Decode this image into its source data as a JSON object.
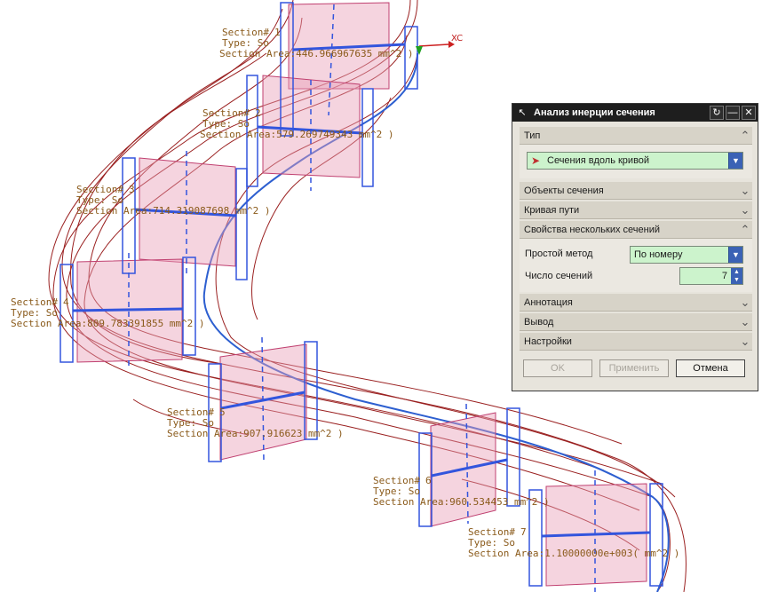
{
  "viewport": {
    "axis_label": "XC",
    "section_labels": [
      {
        "name": "Section#",
        "num": "1",
        "type": "Type: So",
        "area": "Section Area:446.966967635 mm^2 )"
      },
      {
        "name": "Section#",
        "num": "2",
        "type": "Type: So",
        "area": "Section Area:579.269749343 mm^2 )"
      },
      {
        "name": "Section#",
        "num": "3",
        "type": "Type: So",
        "area": "Section Area:714.319087698 mm^2 )"
      },
      {
        "name": "Section#",
        "num": "4",
        "type": "Type: So",
        "area": "Section Area:809.783391855 mm^2 )"
      },
      {
        "name": "Section#",
        "num": "5",
        "type": "Type: So",
        "area": "Section Area:907.916623 mm^2 )"
      },
      {
        "name": "Section#",
        "num": "6",
        "type": "Type: So",
        "area": "Section Area:960.534453 mm^2 )"
      },
      {
        "name": "Section#",
        "num": "7",
        "type": "Type: So",
        "area": "Section Area:1.10000000e+003( mm^2 )"
      }
    ]
  },
  "dialog": {
    "title": "Анализ инерции сечения",
    "icons": {
      "app": "cursor-icon",
      "reset": "reset-icon",
      "minimize": "minimize-icon",
      "close": "close-icon"
    },
    "sections": {
      "type": "Тип",
      "objects": "Объекты сечения",
      "path": "Кривая пути",
      "multi": "Свойства нескольких сечений",
      "annotation": "Аннотация",
      "output": "Вывод",
      "settings": "Настройки"
    },
    "type_value": "Сечения вдоль кривой",
    "simple_method_label": "Простой метод",
    "simple_method_value": "По номеру",
    "count_label": "Число сечений",
    "count_value": "7",
    "buttons": {
      "ok": "OK",
      "apply": "Применить",
      "cancel": "Отмена"
    }
  }
}
